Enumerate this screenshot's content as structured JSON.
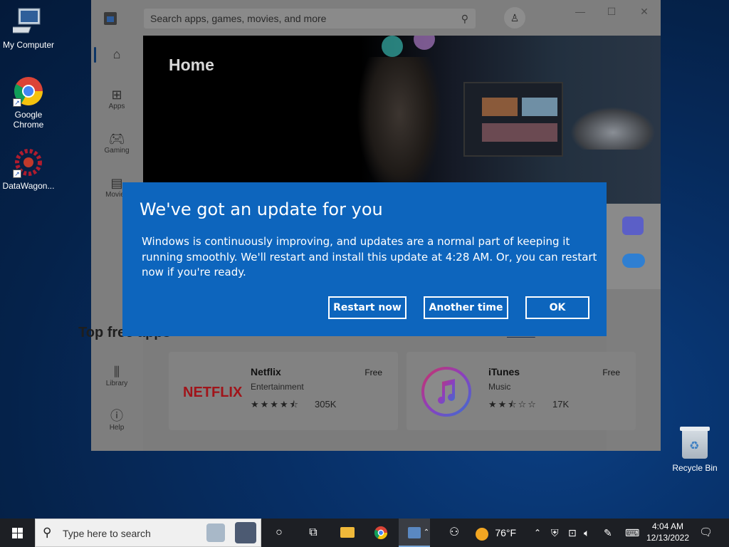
{
  "desktop": {
    "icons": [
      {
        "label": "My Computer"
      },
      {
        "label": "Google Chrome"
      },
      {
        "label": "DataWagon..."
      },
      {
        "label": "Recycle Bin"
      }
    ]
  },
  "store": {
    "search_placeholder": "Search apps, games, movies, and more",
    "nav": [
      {
        "label": "",
        "icon": "home-icon"
      },
      {
        "label": "Apps",
        "icon": "apps-icon"
      },
      {
        "label": "Gaming",
        "icon": "gamepad-icon"
      },
      {
        "label": "Movies",
        "icon": "clapper-icon"
      },
      {
        "label": "Library",
        "icon": "library-icon"
      },
      {
        "label": "Help",
        "icon": "help-icon"
      }
    ],
    "hero_title": "Home",
    "section_title": "Top free apps",
    "see_all": "See all",
    "apps": [
      {
        "name": "Netflix",
        "category": "Entertainment",
        "price": "Free",
        "rating": 4.5,
        "reviews": "305K",
        "logo_text": "NETFLIX"
      },
      {
        "name": "iTunes",
        "category": "Music",
        "price": "Free",
        "rating": 2.5,
        "reviews": "17K"
      }
    ]
  },
  "dialog": {
    "title": "We've got an update for you",
    "body": "Windows is continuously improving, and updates are a normal part of keeping it running smoothly. We'll restart and install this update at 4:28 AM. Or, you can restart now if you're ready.",
    "buttons": {
      "restart": "Restart now",
      "later": "Another time",
      "ok": "OK"
    }
  },
  "taskbar": {
    "search_placeholder": "Type here to search",
    "weather": "76°F",
    "time": "4:04 AM",
    "date": "12/13/2022"
  },
  "colors": {
    "dialog_bg": "#0d65bd",
    "taskbar_bg": "#1d1f24",
    "netflix_red": "#c7111a"
  }
}
